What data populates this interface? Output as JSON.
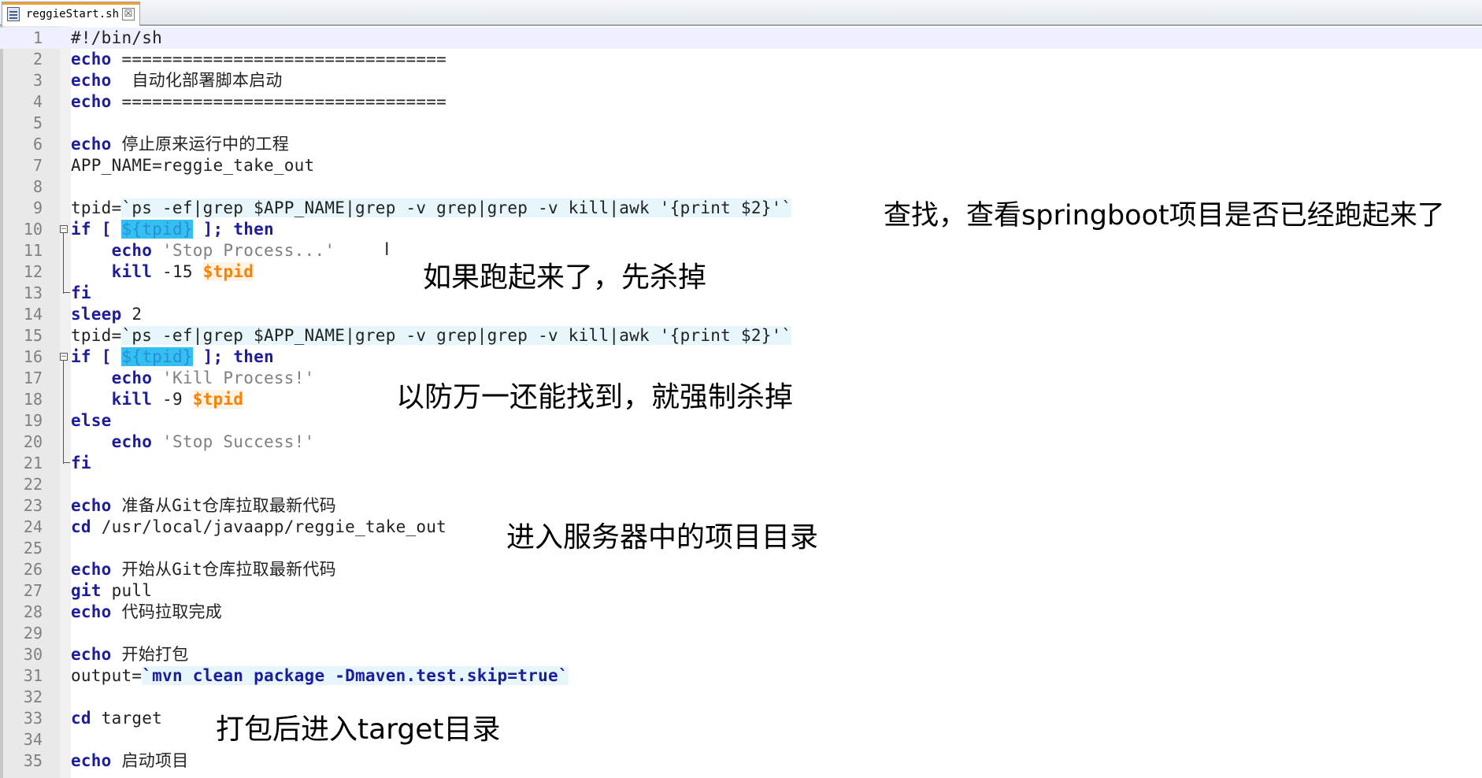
{
  "tab": {
    "label": "reggieStart.sh",
    "close": "☒"
  },
  "icons": {
    "tab_file": "script-file-icon",
    "close": "close-icon",
    "fold": "fold-icon"
  },
  "colors": {
    "keyword": "#1c1c9c",
    "string": "#808080",
    "variable": "#ff8000",
    "selection": "#33c0f0",
    "gutter": "#e9e9e9"
  },
  "lines": {
    "n1": "1",
    "n2": "2",
    "n3": "3",
    "n4": "4",
    "n5": "5",
    "n6": "6",
    "n7": "7",
    "n8": "8",
    "n9": "9",
    "n10": "10",
    "n11": "11",
    "n12": "12",
    "n13": "13",
    "n14": "14",
    "n15": "15",
    "n16": "16",
    "n17": "17",
    "n18": "18",
    "n19": "19",
    "n20": "20",
    "n21": "21",
    "n22": "22",
    "n23": "23",
    "n24": "24",
    "n25": "25",
    "n26": "26",
    "n27": "27",
    "n28": "28",
    "n29": "29",
    "n30": "30",
    "n31": "31",
    "n32": "32",
    "n33": "33",
    "n34": "34",
    "n35": "35"
  },
  "code": {
    "l1": "#!/bin/sh",
    "echo": "echo",
    "eq": " ================================",
    "l3": "  自动化部署脚本启动",
    "l6": " 停止原来运行中的工程",
    "l7": "APP_NAME=reggie_take_out",
    "tpid_eq": "tpid=",
    "l9_bt": "`ps -ef|grep $APP_NAME|grep -v grep|grep -v kill|awk '{print $2}'`",
    "if": "if",
    "bracket_open": " [ ",
    "tpid_sel": "${tpid}",
    "bracket_close": " ]; ",
    "then": "then",
    "indent": "    ",
    "stop_process": " 'Stop Process...'",
    "kill": "kill",
    "minus15": " -15 ",
    "tpid_var": "$tpid",
    "fi": "fi",
    "sleep": "sleep",
    "two": " 2",
    "kill_process": " 'Kill Process!'",
    "minus9": " -9 ",
    "else": "else",
    "stop_success": " 'Stop Success!'",
    "l23": " 准备从Git仓库拉取最新代码",
    "cd": "cd",
    "l24": " /usr/local/javaapp/reggie_take_out",
    "l26": " 开始从Git仓库拉取最新代码",
    "git": "git",
    "pull": " pull",
    "l28": " 代码拉取完成",
    "l30": " 开始打包",
    "output_eq": "output=",
    "l31_bt": "`mvn clean package -Dmaven.test.skip=true`",
    "target": " target",
    "l35": " 启动项目"
  },
  "annotations": {
    "a1": "查找，查看springboot项目是否已经跑起来了",
    "a2": "如果跑起来了，先杀掉",
    "a3": "以防万一还能找到，就强制杀掉",
    "a4": "进入服务器中的项目目录",
    "a5": "打包后进入target目录"
  },
  "cursor": "I"
}
